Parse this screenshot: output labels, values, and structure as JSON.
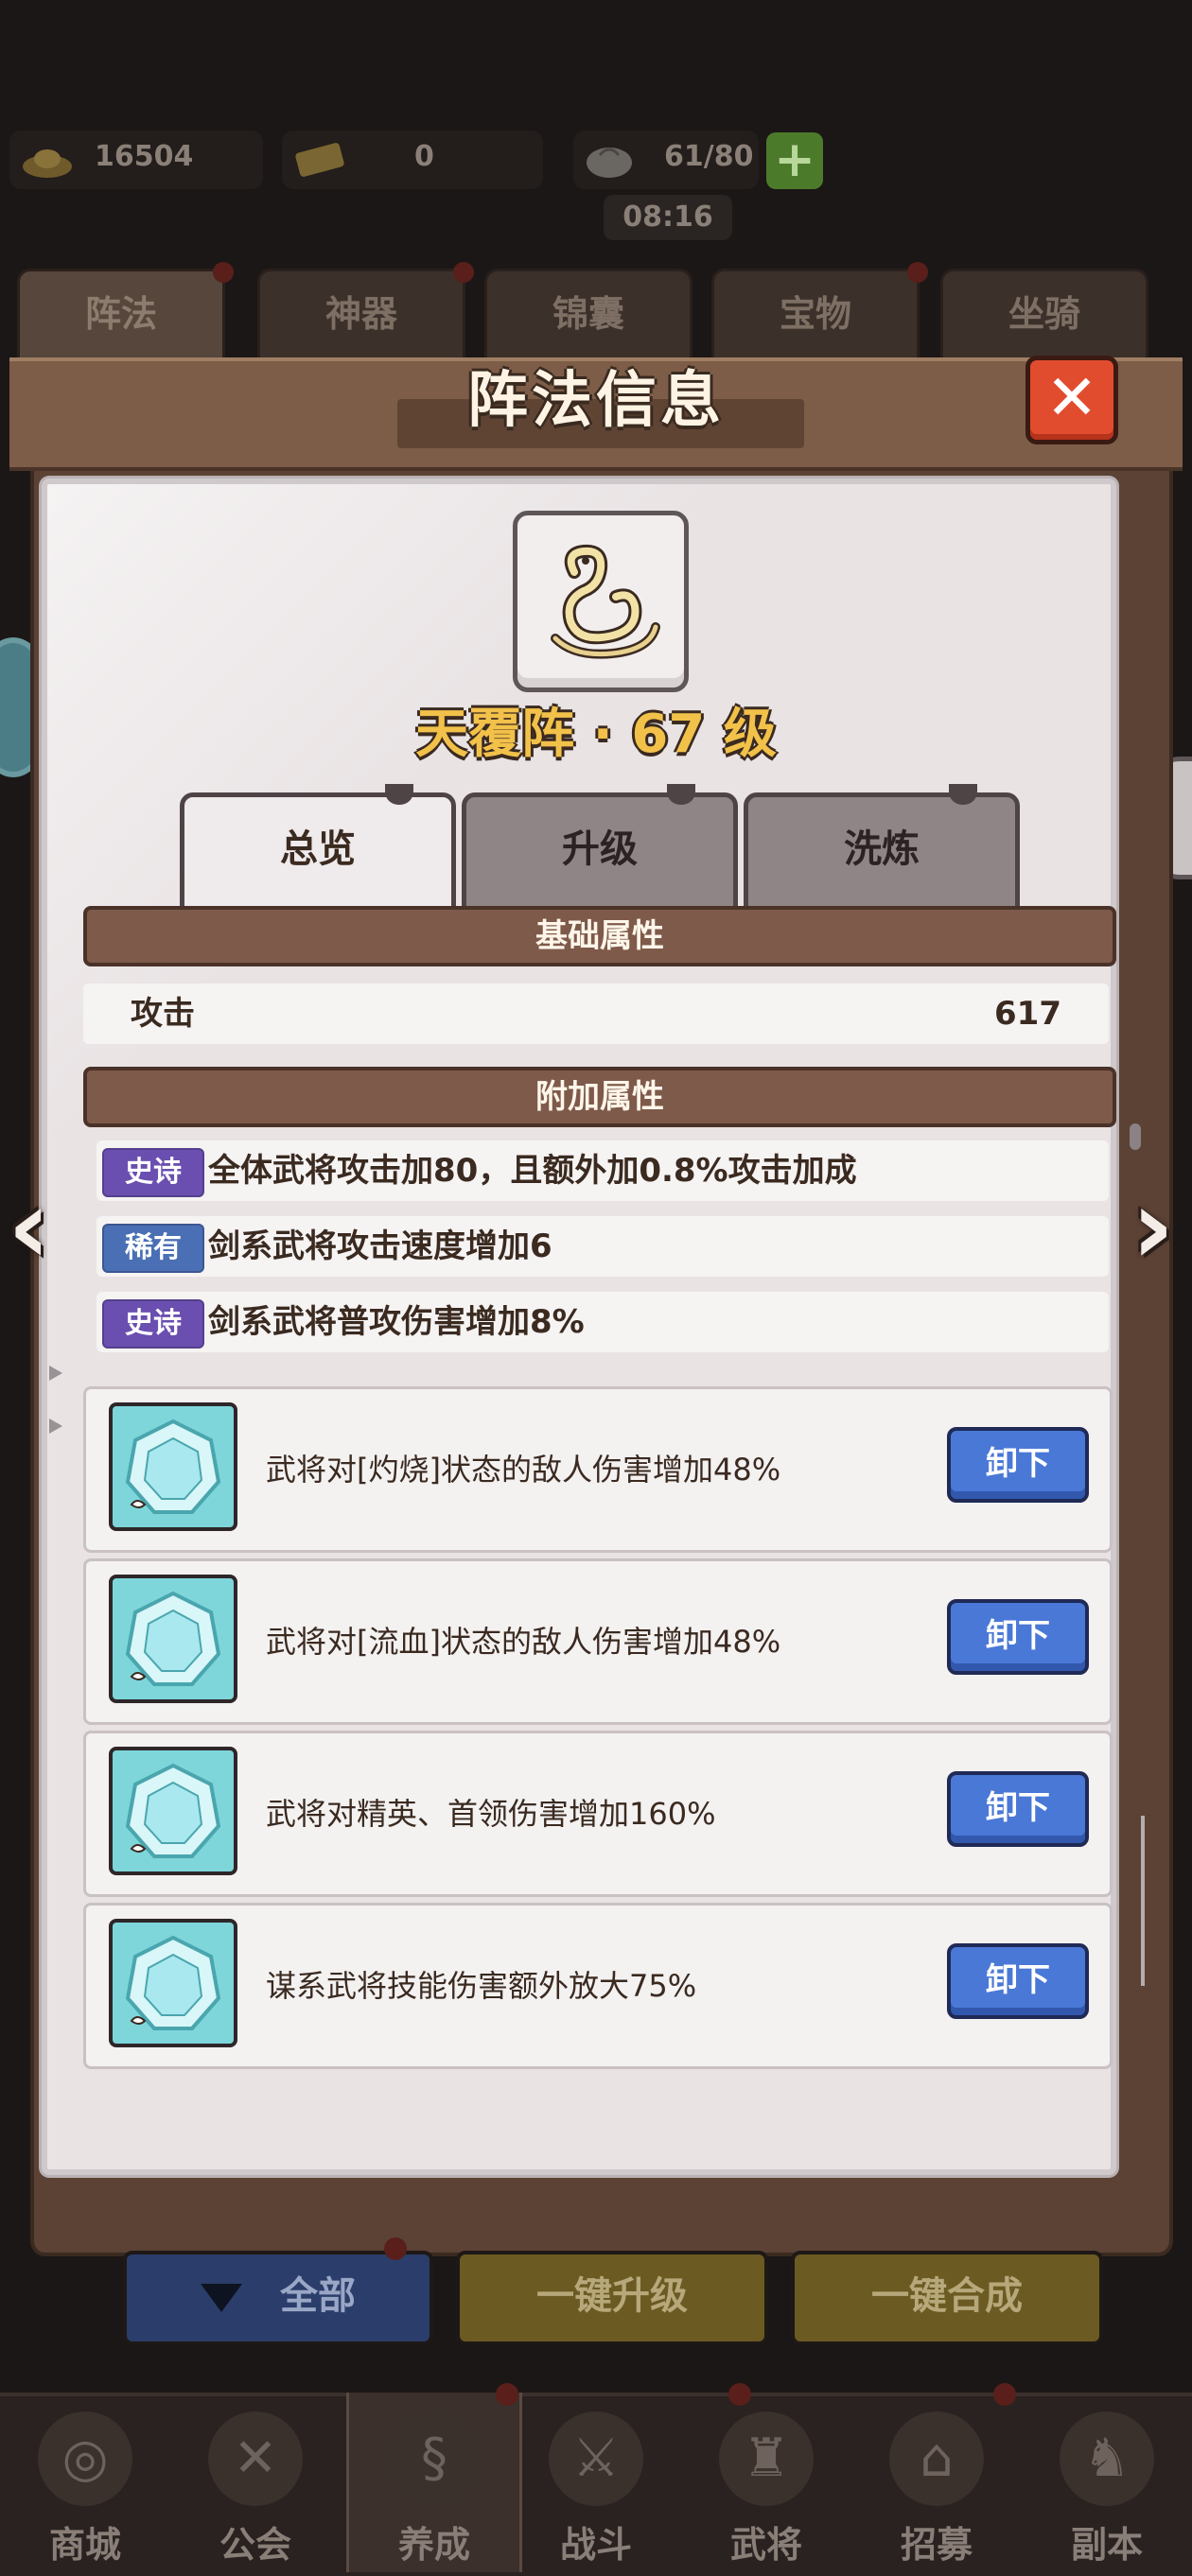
{
  "top_bar": {
    "gold": "16504",
    "ticket": "0",
    "stamina": "61/80",
    "add_icon": "+",
    "timer": "08:16"
  },
  "category_tabs": [
    "阵法",
    "神器",
    "锦囊",
    "宝物",
    "坐骑"
  ],
  "modal": {
    "title": "阵法信息",
    "close_icon": "✕",
    "formation_name": "天覆阵 · 67 级",
    "sub_tabs": [
      "总览",
      "升级",
      "洗炼"
    ],
    "base_section": "基础属性",
    "base_stats": [
      {
        "label": "攻击",
        "value": "617"
      }
    ],
    "extra_section": "附加属性",
    "extra_stats": [
      {
        "badge": "史诗",
        "badge_color": "#6a4fb0",
        "text": "全体武将攻击加80，且额外加0.8%攻击加成"
      },
      {
        "badge": "稀有",
        "badge_color": "#4a6fb4",
        "text": "剑系武将攻击速度增加6"
      },
      {
        "badge": "史诗",
        "badge_color": "#6a4fb0",
        "text": "剑系武将普攻伤害增加8%"
      }
    ],
    "gems": [
      {
        "text": "武将对[灼烧]状态的敌人伤害增加48%",
        "button": "卸下"
      },
      {
        "text": "武将对[流血]状态的敌人伤害增加48%",
        "button": "卸下"
      },
      {
        "text": "武将对精英、首领伤害增加160%",
        "button": "卸下"
      },
      {
        "text": "谋系武将技能伤害额外放大75%",
        "button": "卸下"
      }
    ],
    "prev_icon": "‹",
    "next_icon": "›"
  },
  "actions": {
    "filter": "全部",
    "upgrade_all": "一键升级",
    "merge_all": "一键合成"
  },
  "bottom_nav": [
    "商城",
    "公会",
    "养成",
    "战斗",
    "武将",
    "招募",
    "副本"
  ],
  "colors": {
    "accent_gold": "#f2c14a",
    "close_red": "#e24c2e",
    "button_blue": "#4a78d6",
    "gem_cyan": "#7ed6da"
  }
}
